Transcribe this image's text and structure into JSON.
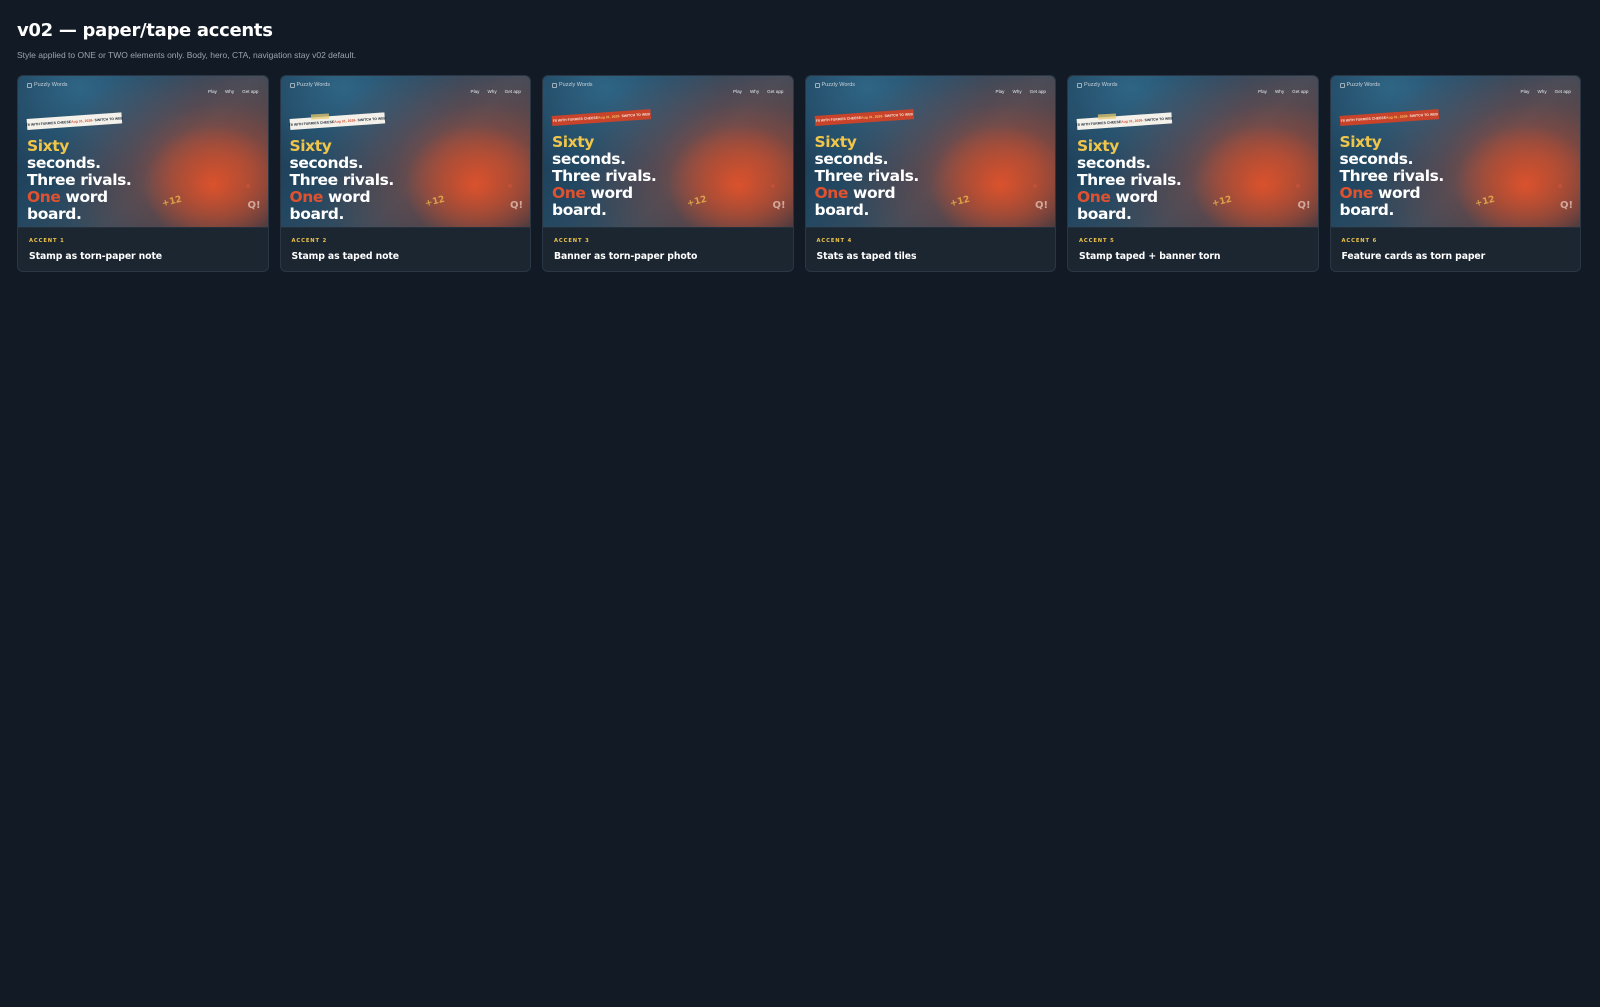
{
  "page": {
    "title": "v02 — paper/tape accents",
    "subtitle": "Style applied to ONE or TWO elements only. Body, hero, CTA, navigation stay v02 default."
  },
  "preview": {
    "logo_alt": "Puzzly Words",
    "nav": [
      "Play",
      "Why",
      "Get app"
    ],
    "stamp_text_before": "F8 WITH FURRIES CHEESE ",
    "stamp_date": "Aug 31, 2026",
    "stamp_text_after": " · SWITCH TO WEB",
    "headline": {
      "line1": "Sixty",
      "line2": "seconds.",
      "line3": "Three rivals.",
      "line4_accent": "One",
      "line4_rest": " word",
      "line5": "board."
    },
    "score": "+12",
    "mark": "Q!"
  },
  "cards": [
    {
      "label": "ACCENT 1",
      "title": "Stamp as torn-paper note"
    },
    {
      "label": "ACCENT 2",
      "title": "Stamp as taped note"
    },
    {
      "label": "ACCENT 3",
      "title": "Banner as torn-paper photo"
    },
    {
      "label": "ACCENT 4",
      "title": "Stats as taped tiles"
    },
    {
      "label": "ACCENT 5",
      "title": "Stamp taped + banner torn"
    },
    {
      "label": "ACCENT 6",
      "title": "Feature cards as torn paper"
    }
  ],
  "colors": {
    "background": "#121b25",
    "card": "#1b2631",
    "accent_yellow": "#f0c64a",
    "accent_red": "#e0522f"
  }
}
